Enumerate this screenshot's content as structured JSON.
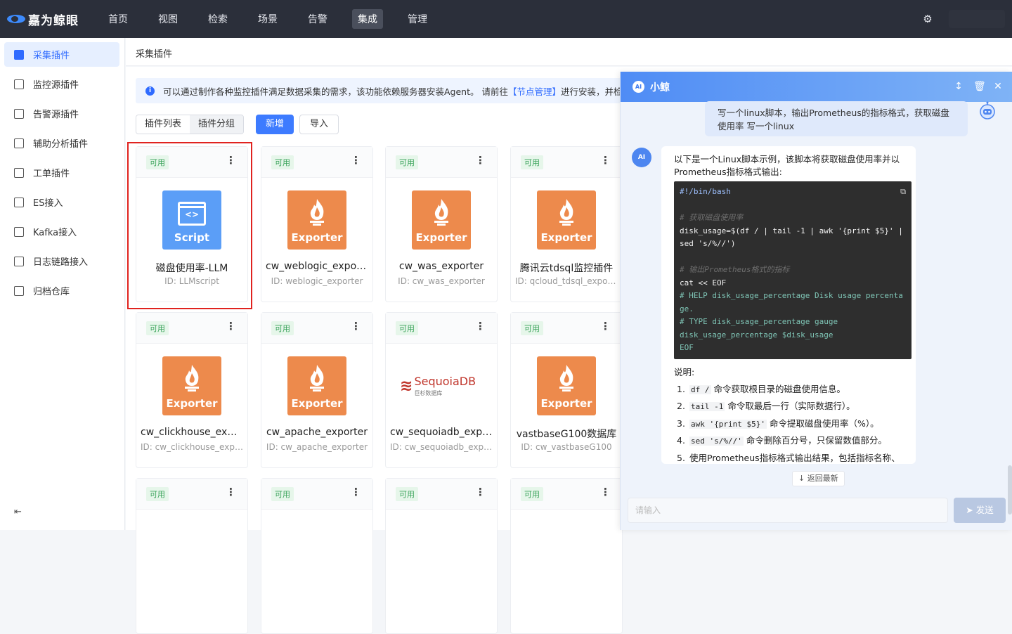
{
  "app": {
    "logo_text": "嘉为鲸眼"
  },
  "nav": {
    "items": [
      {
        "label": "首页"
      },
      {
        "label": "视图"
      },
      {
        "label": "检索"
      },
      {
        "label": "场景"
      },
      {
        "label": "告警"
      },
      {
        "label": "集成"
      },
      {
        "label": "管理"
      }
    ],
    "active_index": 5,
    "settings_icon": "gear-icon"
  },
  "sidebar": {
    "items": [
      {
        "label": "采集插件",
        "icon": "plugin-icon"
      },
      {
        "label": "监控源插件",
        "icon": "monitor-source-icon"
      },
      {
        "label": "告警源插件",
        "icon": "alert-source-icon"
      },
      {
        "label": "辅助分析插件",
        "icon": "analysis-icon"
      },
      {
        "label": "工单插件",
        "icon": "ticket-icon"
      },
      {
        "label": "ES接入",
        "icon": "cloud-icon"
      },
      {
        "label": "Kafka接入",
        "icon": "kafka-icon"
      },
      {
        "label": "日志链路接入",
        "icon": "log-icon"
      },
      {
        "label": "归档仓库",
        "icon": "archive-icon"
      }
    ],
    "active_index": 0,
    "collapse_glyph": "⇤"
  },
  "page": {
    "breadcrumb": "采集插件",
    "notice": {
      "text_before": "可以通过制作各种监控插件满足数据采集的需求，该功能依赖服务器安装Agent。 请前往",
      "link": "【节点管理】",
      "text_after": "进行安装，并检查"
    },
    "toolbar": {
      "tab_list": "插件列表",
      "tab_group": "插件分组",
      "add": "新增",
      "import": "导入"
    }
  },
  "cards": [
    {
      "status": "可用",
      "tile": "Script",
      "name": "磁盘使用率-LLM",
      "id": "ID: LLMscript"
    },
    {
      "status": "可用",
      "tile": "Exporter",
      "name": "cw_weblogic_exporter",
      "id": "ID: weblogic_exporter"
    },
    {
      "status": "可用",
      "tile": "Exporter",
      "name": "cw_was_exporter",
      "id": "ID: cw_was_exporter"
    },
    {
      "status": "可用",
      "tile": "Exporter",
      "name": "腾讯云tdsql监控插件",
      "id": "ID: qcloud_tdsql_exporter"
    },
    {
      "status": "可用",
      "tile": "Exporter",
      "name": "cw_clickhouse_exporter",
      "id": "ID: cw_clickhouse_exporter"
    },
    {
      "status": "可用",
      "tile": "Exporter",
      "name": "cw_apache_exporter",
      "id": "ID: cw_apache_exporter"
    },
    {
      "status": "可用",
      "tile": "SequoiaDB",
      "tile_sub": "巨杉数据库",
      "name": "cw_sequoiadb_exporter",
      "id": "ID: cw_sequoiadb_exporter"
    },
    {
      "status": "可用",
      "tile": "Exporter",
      "name": "vastbaseG100数据库",
      "id": "ID: cw_vastbaseG100"
    },
    {
      "status": "可用"
    },
    {
      "status": "可用"
    },
    {
      "status": "可用"
    },
    {
      "status": "可用"
    }
  ],
  "chat": {
    "title": "小鲸",
    "ai_label": "AI",
    "user_message": "写一个linux脚本，输出Prometheus的指标格式，获取磁盘使用率 写一个linux",
    "bot_intro": "以下是一个Linux脚本示例，该脚本将获取磁盘使用率并以Prometheus指标格式输出:",
    "code_lines": [
      "#!/bin/bash",
      "",
      "# 获取磁盘使用率",
      "disk_usage=$(df / | tail -1 | awk '{print $5}' | sed 's/%//')",
      "",
      "# 输出Prometheus格式的指标",
      "cat << EOF",
      "# HELP disk_usage_percentage Disk usage percentage.",
      "# TYPE disk_usage_percentage gauge",
      "disk_usage_percentage $disk_usage",
      "EOF"
    ],
    "desc_title": "说明:",
    "steps": [
      {
        "code": "df /",
        "text": " 命令获取根目录的磁盘使用信息。"
      },
      {
        "code": "tail -1",
        "text": " 命令取最后一行（实际数据行）。"
      },
      {
        "code": "awk '{print $5}'",
        "text": " 命令提取磁盘使用率（%）。"
      },
      {
        "code": "sed 's/%//'",
        "text": " 命令删除百分号，只保留数值部分。"
      },
      {
        "code": "",
        "text": "使用Prometheus指标格式输出结果，包括指标名称、"
      }
    ],
    "back_latest": "返回最新",
    "input_placeholder": "请输入",
    "send": "发送"
  }
}
